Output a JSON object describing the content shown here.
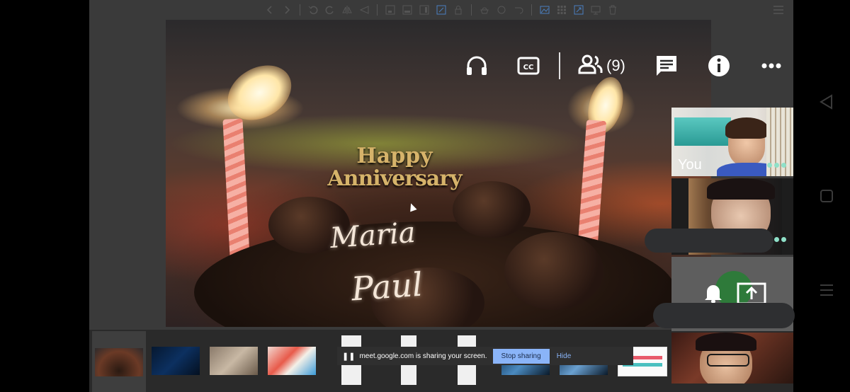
{
  "toolbar": {
    "icons": [
      "back-icon",
      "forward-icon",
      "undo-icon",
      "redo-icon",
      "flip-horizontal-icon",
      "flip-vertical-icon",
      "crop-icon",
      "fit-width-icon",
      "fit-height-icon",
      "fit-screen-icon",
      "lock-icon",
      "paint-bucket-icon",
      "rotate-icon",
      "redo-arrow-icon",
      "image-icon",
      "grid-icon",
      "zoom-icon",
      "slideshow-icon",
      "delete-icon"
    ],
    "menu_icon": "hamburger-menu-icon"
  },
  "slide": {
    "topper_line1": "Happy",
    "topper_line2": "Anniversary",
    "cake_writing_1": "Maria",
    "cake_writing_2": "Paul"
  },
  "meet_controls": {
    "audio_icon": "headphones-icon",
    "captions_icon": "closed-captions-icon",
    "people_icon": "people-icon",
    "participant_count": "(9)",
    "chat_icon": "chat-icon",
    "info_icon": "info-icon",
    "more_icon": "more-options-icon"
  },
  "participants": {
    "you_label": "You"
  },
  "share_bar": {
    "message": "meet.google.com is sharing your screen.",
    "stop_label": "Stop sharing",
    "hide_label": "Hide"
  },
  "android_nav": {
    "back": "back-triangle-icon",
    "home": "home-square-icon",
    "recents": "recents-icon"
  },
  "colors": {
    "share_button": "#8ab4f8",
    "speaking_dots": "#8fe0c8",
    "background": "#3a3a3a"
  }
}
